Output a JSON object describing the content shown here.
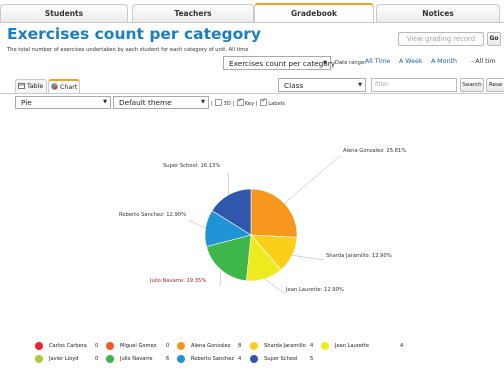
{
  "tabs": [
    {
      "label": "Students"
    },
    {
      "label": "Teachers"
    },
    {
      "label": "Gradebook"
    },
    {
      "label": "Notices"
    }
  ],
  "header": {
    "title": "Exercises count per category",
    "subtitle": "The total number of exercises undertaken by each student for each category of unit. All time",
    "view_grading_label": "View grading record",
    "go_label": "Go"
  },
  "filters": {
    "report_select": "Exercises count per category",
    "date_range_label": "Date range:",
    "date_links": [
      "All Time",
      "A Week",
      "A Month",
      "- All tim"
    ],
    "class_select": "Class",
    "filter_placeholder": "filter",
    "search_label": "Search",
    "reset_label": "Rese"
  },
  "view_tabs": {
    "table_label": "Table",
    "chart_label": "Chart"
  },
  "chart_options": {
    "type_select": "Pie",
    "theme_select": "Default theme",
    "opt_3d": "3D",
    "opt_key": "Key",
    "opt_labels": "Labels",
    "sep": "|"
  },
  "chart_data": {
    "type": "pie",
    "series": [
      {
        "name": "Alena Gonzalez",
        "value": 8,
        "label": "Alena Gonzalez: 25.81%",
        "color": "#f7971e"
      },
      {
        "name": "Sharda Jaramillo",
        "value": 4,
        "label": "Sharda Jaramillo: 12.90%",
        "color": "#fbcf17"
      },
      {
        "name": "Jean Laurette",
        "value": 4,
        "label": "Jean Laurette: 12.90%",
        "color": "#ecec1e"
      },
      {
        "name": "Julio Navarre",
        "value": 6,
        "label": "Julio Navarre: 19.35%",
        "color": "#3db64c"
      },
      {
        "name": "Roberto Sanchez",
        "value": 4,
        "label": "Roberto Sanchez: 12.90%",
        "color": "#1f93d6"
      },
      {
        "name": "Super School",
        "value": 5,
        "label": "Super School: 16.13%",
        "color": "#2f58ad"
      }
    ]
  },
  "legend": [
    {
      "name": "Carlos Carbera",
      "value": "0",
      "color": "#e8222e"
    },
    {
      "name": "Miguel Gomez",
      "value": "0",
      "color": "#f15a24"
    },
    {
      "name": "Alena Gonzalez",
      "value": "8",
      "color": "#f7971e"
    },
    {
      "name": "Sharda Jaramillo",
      "value": "4",
      "color": "#fbcf17"
    },
    {
      "name": "Jean Laurette",
      "value": "4",
      "color": "#ecec1e"
    },
    {
      "name": "Javier Lloyd",
      "value": "0",
      "color": "#a6ce39"
    },
    {
      "name": "Julio Navarre",
      "value": "6",
      "color": "#3db64c"
    },
    {
      "name": "Roberto Sanchez",
      "value": "4",
      "color": "#1f93d6"
    },
    {
      "name": "Super School",
      "value": "5",
      "color": "#2f58ad"
    }
  ],
  "colors": {
    "accent": "#1a7fc1",
    "tab_highlight": "#f0a020",
    "link": "#1a66b8"
  }
}
